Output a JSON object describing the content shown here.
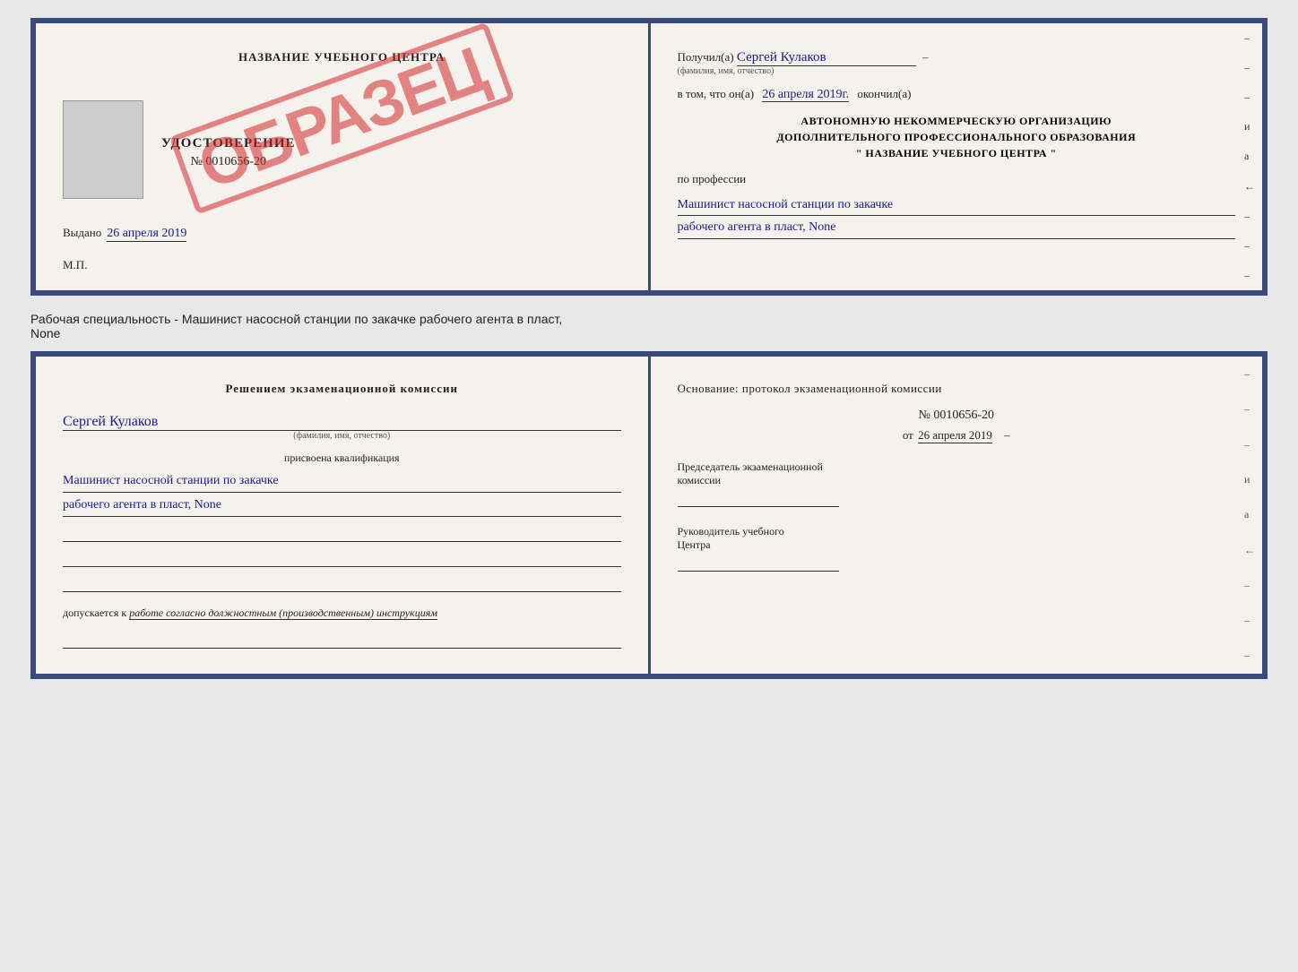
{
  "page": {
    "background": "#e8e8e8"
  },
  "top_cert": {
    "left": {
      "header": "НАЗВАНИЕ УЧЕБНОГО ЦЕНТРА",
      "obrazets": "ОБРАЗЕЦ",
      "udostoverenie_label": "УДОСТОВЕРЕНИЕ",
      "udostoverenie_num": "№ 0010656-20",
      "vydano_prefix": "Выдано",
      "vydano_date": "26 апреля 2019",
      "mp_label": "М.П."
    },
    "right": {
      "poluchil_prefix": "Получил(а)",
      "poluchil_name": "Сергей Кулаков",
      "familiya_hint": "(фамилия, имя, отчество)",
      "vtom_prefix": "в том, что он(а)",
      "vtom_date": "26 апреля 2019г.",
      "okonchil": "окончил(а)",
      "avtonomnuyu_line1": "АВТОНОМНУЮ НЕКОММЕРЧЕСКУЮ ОРГАНИЗАЦИЮ",
      "avtonomnuyu_line2": "ДОПОЛНИТЕЛЬНОГО ПРОФЕССИОНАЛЬНОГО ОБРАЗОВАНИЯ",
      "center_name": "\" НАЗВАНИЕ УЧЕБНОГО ЦЕНТРА \"",
      "po_professii": "по профессии",
      "profession_line1": "Машинист насосной станции по закачке",
      "profession_line2": "рабочего агента в пласт, None",
      "dashes": [
        "-",
        "-",
        "-",
        "и",
        "а",
        "←",
        "-",
        "-",
        "-"
      ]
    }
  },
  "info_text": {
    "line1": "Рабочая специальность - Машинист насосной станции по закачке рабочего агента в пласт,",
    "line2": "None"
  },
  "bottom_cert": {
    "left": {
      "header": "Решением экзаменационной комиссии",
      "name": "Сергей Кулаков",
      "familiya_hint": "(фамилия, имя, отчество)",
      "prisvoyena": "присвоена квалификация",
      "qual_line1": "Машинист насосной станции по закачке",
      "qual_line2": "рабочего агента в пласт, None",
      "dopuskaetsya_prefix": "допускается к",
      "dopuskaetsya_text": "работе согласно должностным (производственным) инструкциям"
    },
    "right": {
      "osnovanie": "Основание: протокол экзаменационной комиссии",
      "protokol_num": "№ 0010656-20",
      "protokol_date_prefix": "от",
      "protokol_date": "26 апреля 2019",
      "predsedatel_line1": "Председатель экзаменационной",
      "predsedatel_line2": "комиссии",
      "rukovoditel_line1": "Руководитель учебного",
      "rukovoditel_line2": "Центра",
      "dashes": [
        "-",
        "-",
        "-",
        "и",
        "а",
        "←",
        "-",
        "-",
        "-"
      ]
    }
  }
}
